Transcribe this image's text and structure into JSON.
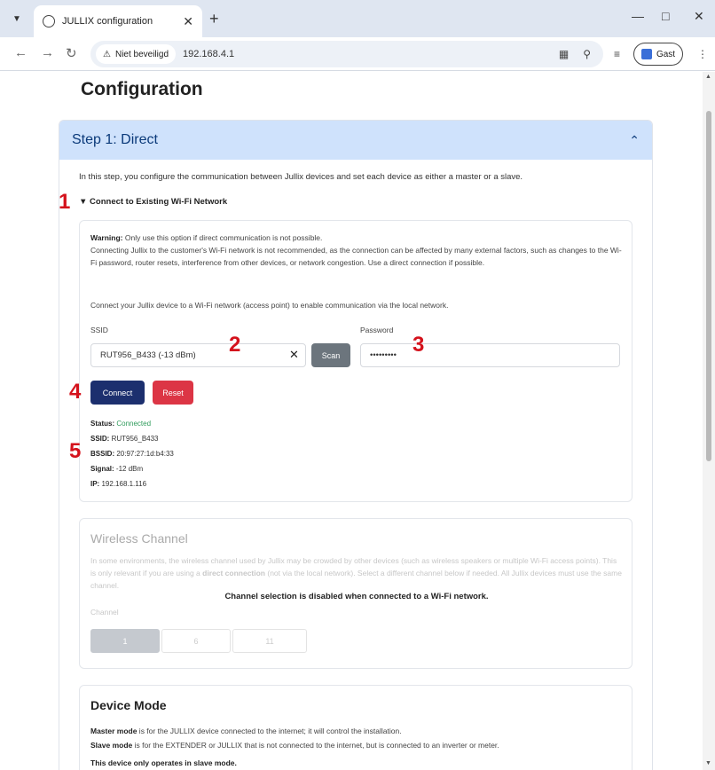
{
  "browser": {
    "tab_title": "JULLIX configuration",
    "security_chip": "Niet beveiligd",
    "url": "192.168.4.1",
    "profile_label": "Gast"
  },
  "page": {
    "title": "Configuration",
    "step_title": "Step 1: Direct",
    "intro": "In this step, you configure the communication between Jullix devices and set each device as either a master or a slave.",
    "details_summary": "Connect to Existing Wi-Fi Network"
  },
  "wifi": {
    "warning_label": "Warning:",
    "warning_text_1": " Only use this option if direct communication is not possible.",
    "warning_text_2": "Connecting Jullix to the customer's Wi-Fi network is not recommended, as the connection can be affected by many external factors, such as changes to the Wi-Fi password, router resets, interference from other devices, or network congestion. Use a direct connection if possible.",
    "instruction": "Connect your Jullix device to a Wi-Fi network (access point) to enable communication via the local network.",
    "ssid_label": "SSID",
    "ssid_value": "RUT956_B433 (-13 dBm)",
    "scan_label": "Scan",
    "password_label": "Password",
    "password_value": "•••••••••",
    "connect_label": "Connect",
    "reset_label": "Reset",
    "status": {
      "status_label": "Status:",
      "status_value": "Connected",
      "ssid_label": "SSID:",
      "ssid_value": "RUT956_B433",
      "bssid_label": "BSSID:",
      "bssid_value": "20:97:27:1d:b4:33",
      "signal_label": "Signal:",
      "signal_value": "-12 dBm",
      "ip_label": "IP:",
      "ip_value": "192.168.1.116"
    }
  },
  "channel": {
    "title": "Wireless Channel",
    "desc_1": "In some environments, the wireless channel used by Jullix may be crowded by other devices (such as wireless speakers or multiple Wi-Fi access points). This is only relevant if you are using a ",
    "desc_bold": "direct connection",
    "desc_2": " (not via the local network). Select a different channel below if needed. All Jullix devices must use the same channel.",
    "channel_label": "Channel",
    "options": [
      "1",
      "6",
      "11"
    ],
    "disabled_note": "Channel selection is disabled when connected to a Wi-Fi network."
  },
  "device_mode": {
    "title": "Device Mode",
    "master_bold": "Master mode",
    "master_text": " is for the JULLIX device connected to the internet; it will control the installation.",
    "slave_bold": "Slave mode",
    "slave_text": " is for the EXTENDER or JULLIX that is not connected to the internet, but is connected to an inverter or meter.",
    "only_slave": "This device only operates in slave mode."
  },
  "annotations": [
    "1",
    "2",
    "3",
    "4",
    "5"
  ],
  "colors": {
    "header_bg": "#cfe2fc",
    "header_text": "#0b3a7a",
    "connect_btn": "#1c2f6e",
    "reset_btn": "#dc3545",
    "scan_btn": "#6c757d",
    "connected": "#2f9b5b",
    "annotation": "#d4121c"
  }
}
